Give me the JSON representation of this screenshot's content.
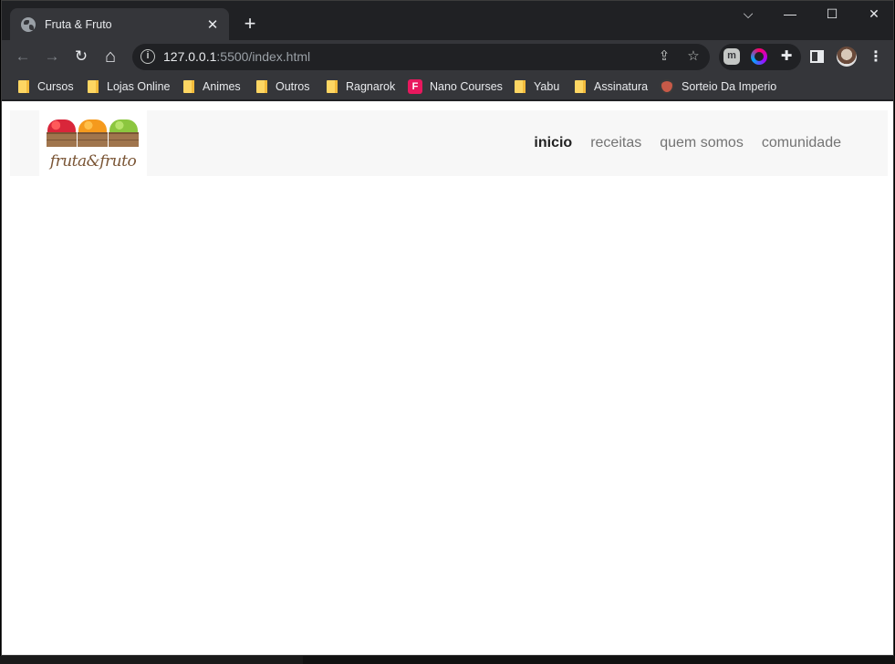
{
  "browser": {
    "tab_title": "Fruta & Fruto",
    "tab_close": "✕",
    "new_tab": "+",
    "window_controls": {
      "tab_search": "⌵",
      "minimize": "—",
      "maximize": "☐",
      "close": "✕"
    },
    "toolbar": {
      "back": "←",
      "forward": "→",
      "reload": "↻",
      "home": "⌂",
      "menu": "⋮"
    },
    "url_host": "127.0.0.1",
    "url_rest": ":5500/index.html",
    "info": "i",
    "omnibox_icons": {
      "share": "⇪",
      "star": "☆"
    },
    "extensions": {
      "m": "m",
      "puzzle": "✚"
    },
    "bookmarks": [
      "Cursos",
      "Lojas Online",
      "Animes",
      "Outros",
      "Ragnarok",
      "Nano Courses",
      "Yabu",
      "Assinatura",
      "Sorteio Da Imperio"
    ],
    "nano_letter": "F"
  },
  "site": {
    "logo_text": "fruta&fruto",
    "nav": [
      {
        "label": "inicio",
        "active": true
      },
      {
        "label": "receitas",
        "active": false
      },
      {
        "label": "quem somos",
        "active": false
      },
      {
        "label": "comunidade",
        "active": false
      }
    ],
    "colors": {
      "header_bg": "#f7f7f7",
      "nav_active": "#222222",
      "nav_inactive": "#737373",
      "crate_wood": "#a0754d",
      "apple": "#d9263a",
      "orange": "#f59a1d",
      "lime": "#8cc63f"
    }
  }
}
